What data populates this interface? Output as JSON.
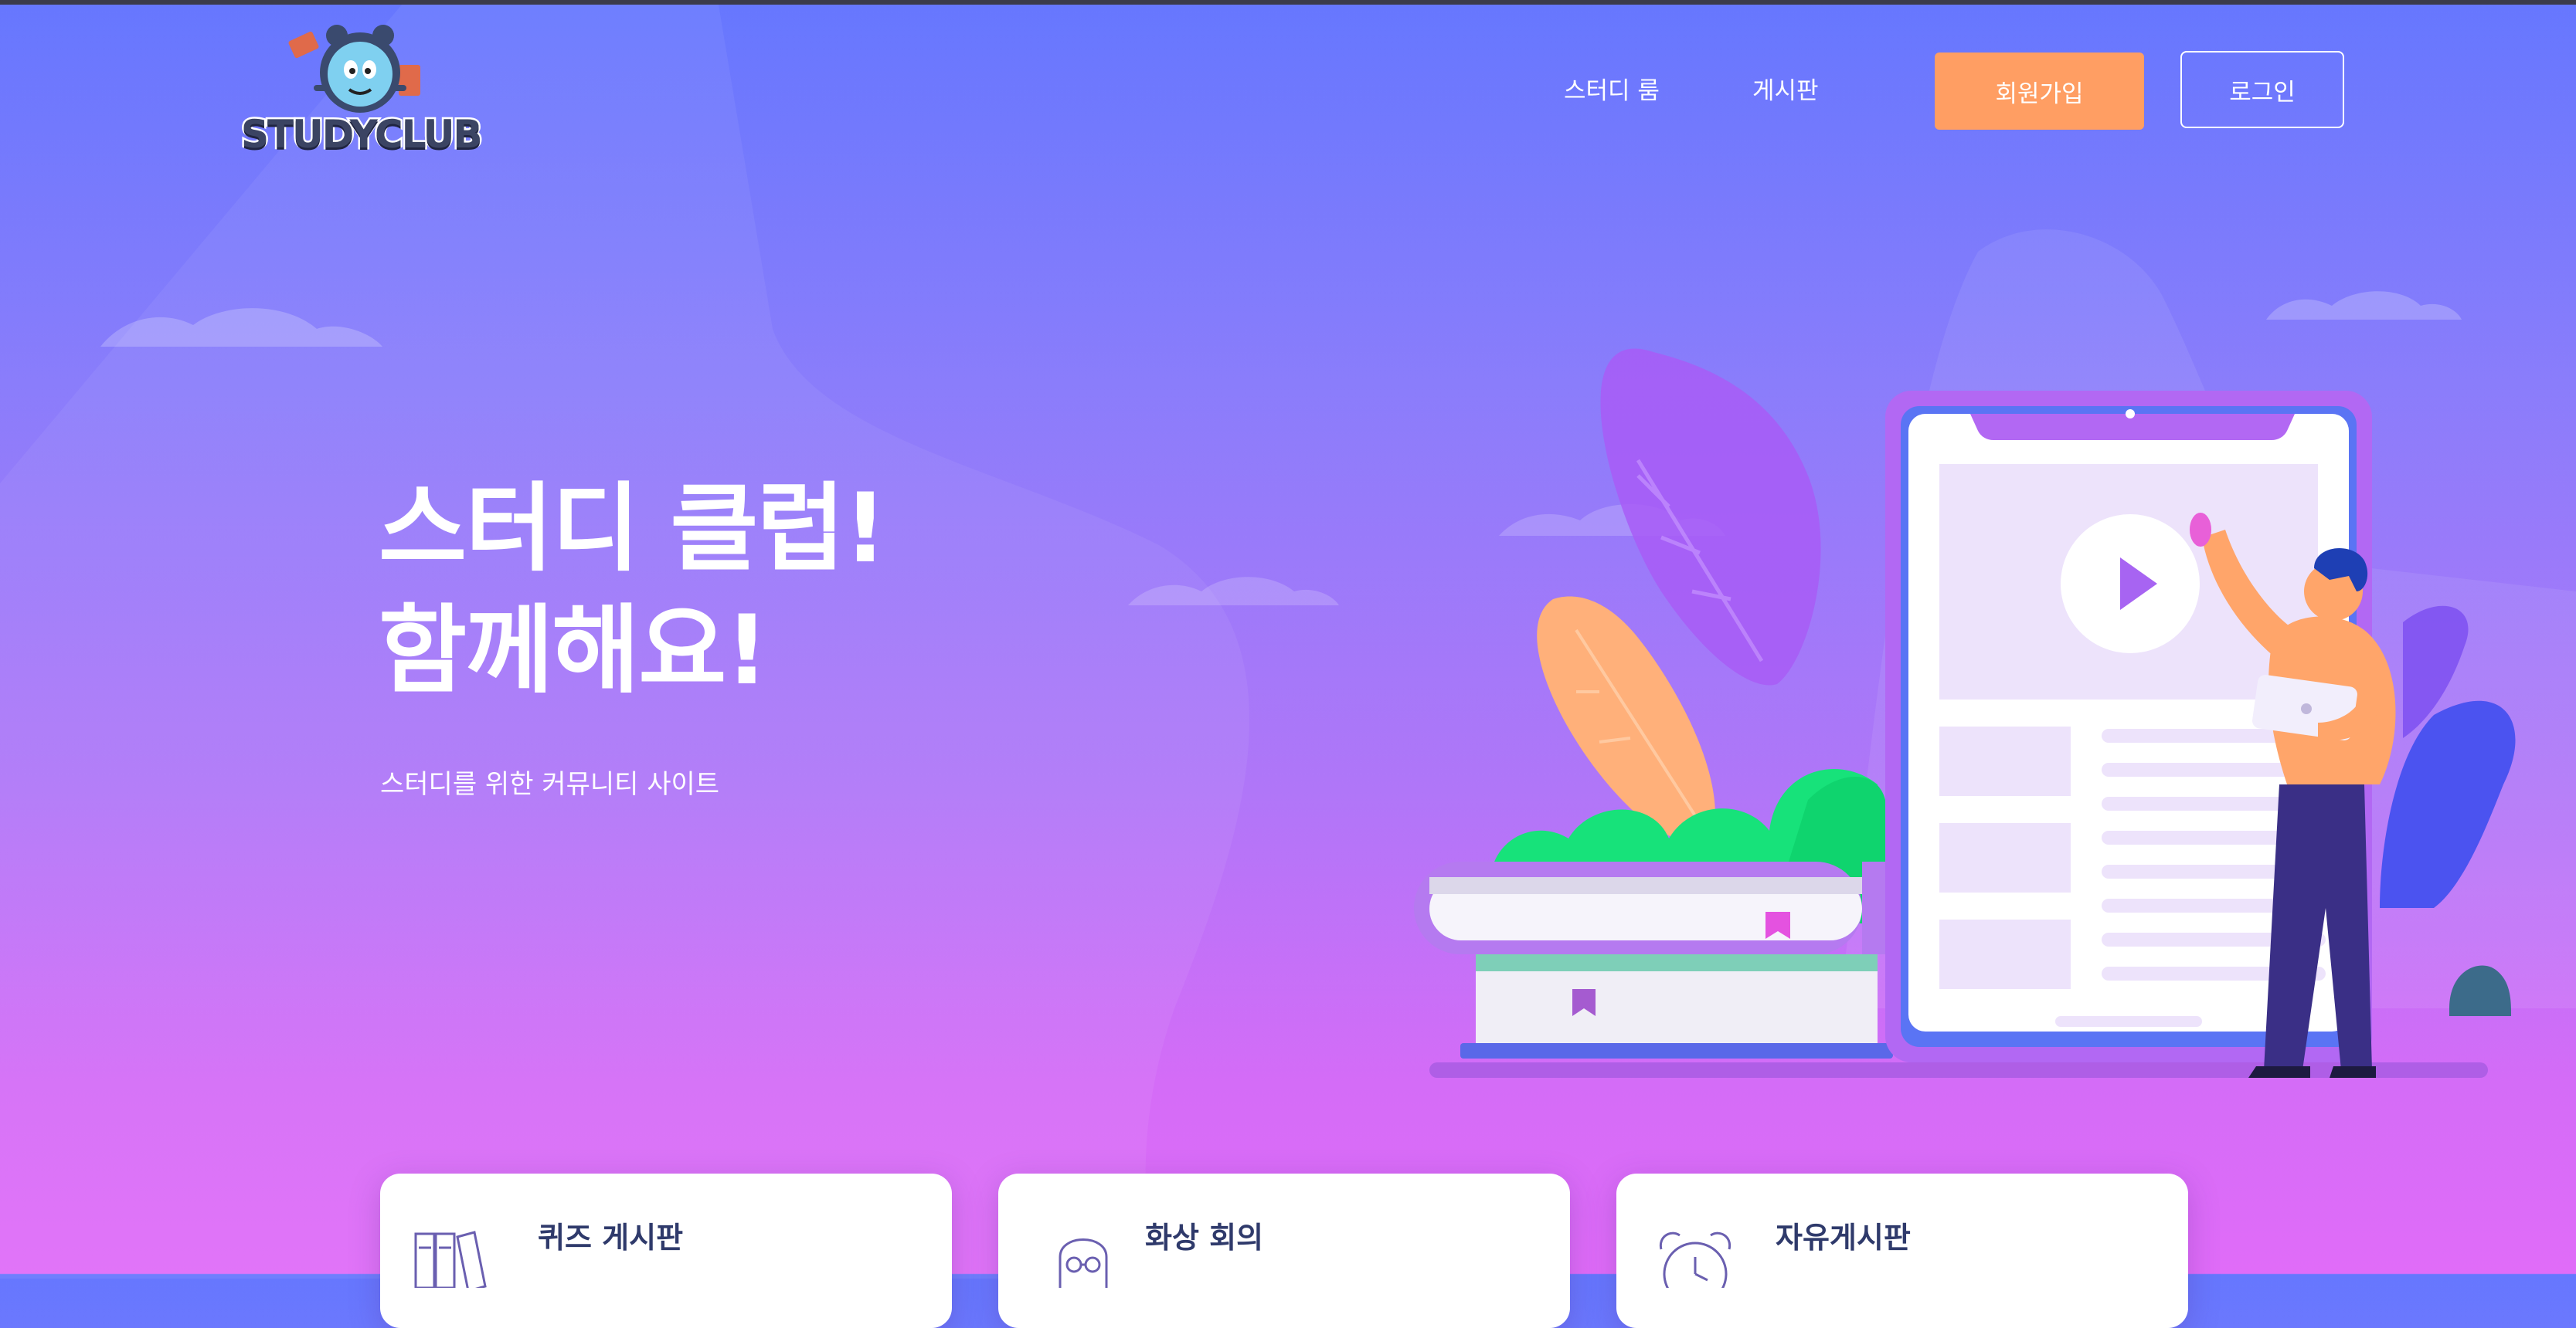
{
  "header": {
    "logo_text": "STUDYCLUB",
    "nav": [
      {
        "label": "스터디 룸"
      },
      {
        "label": "게시판"
      }
    ],
    "signup_label": "회원가입",
    "login_label": "로그인"
  },
  "hero": {
    "title_line1": "스터디 클럽!",
    "title_line2": "함께해요!",
    "subtitle": "스터디를 위한 커뮤니티 사이트"
  },
  "cards": [
    {
      "title": "퀴즈 게시판",
      "icon": "binders-icon"
    },
    {
      "title": "화상 회의",
      "icon": "person-glasses-icon"
    },
    {
      "title": "자유게시판",
      "icon": "alarm-clock-icon"
    }
  ],
  "colors": {
    "accent_orange": "#ff9e63",
    "bg_top": "#6677fe",
    "bg_bottom": "#e06cf8",
    "card_title": "#2f3a6b"
  }
}
